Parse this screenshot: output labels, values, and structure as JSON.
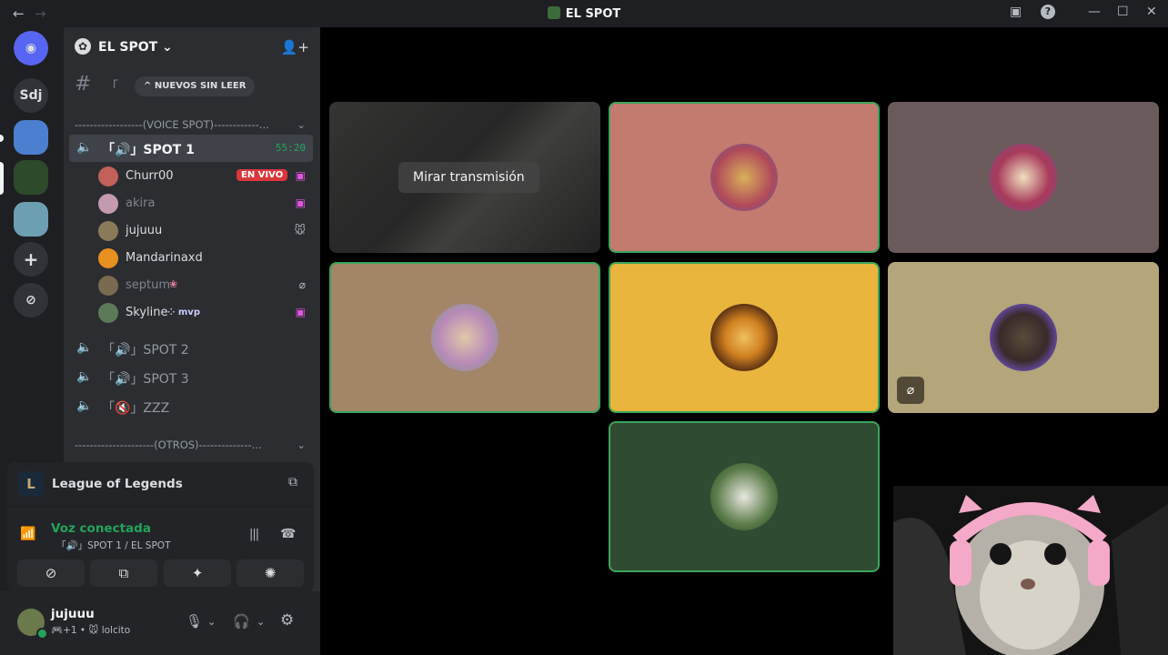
{
  "titlebar": {
    "title": "EL SPOT",
    "back": "←",
    "forward": "→",
    "inbox_icon": "inbox-icon",
    "help": "?",
    "minimize": "—",
    "maximize": "☐",
    "close": "✕"
  },
  "rail": {
    "servers": [
      "Sdj"
    ]
  },
  "server": {
    "name": "EL SPOT",
    "chevron": "⌄",
    "unread_pill": "NUEVOS SIN LEER",
    "text_channel_prefix": "「 "
  },
  "categories": {
    "voice": "------------------(VOICE SPOT)------------...",
    "others": "---------------------(OTROS)--------------..."
  },
  "channels": [
    {
      "label": "「🔊」SPOT 1",
      "timer": "55:20"
    },
    {
      "label": "「🔊」SPOT 2"
    },
    {
      "label": "「🔊」SPOT 3"
    },
    {
      "label": "「🔇」ZZZ"
    }
  ],
  "members": [
    {
      "name": "Churr00",
      "badge": "EN VIVO"
    },
    {
      "name": "akira"
    },
    {
      "name": "jujuuu"
    },
    {
      "name": "Mandarinaxd"
    },
    {
      "name": "septum"
    },
    {
      "name": "Skyline",
      "tag": "mvp"
    }
  ],
  "activity": {
    "name": "League of Legends"
  },
  "voice": {
    "status": "Voz conectada",
    "location": "「🔊」SPOT 1 / EL SPOT"
  },
  "user": {
    "name": "jujuuu",
    "status": "🎮+1 • 🐭 lolcito"
  },
  "stage": {
    "watch_label": "Mirar transmisión"
  },
  "colors": {
    "speaking_border": "#3ba55c",
    "live_badge": "#da373c",
    "connected": "#23a55a"
  }
}
